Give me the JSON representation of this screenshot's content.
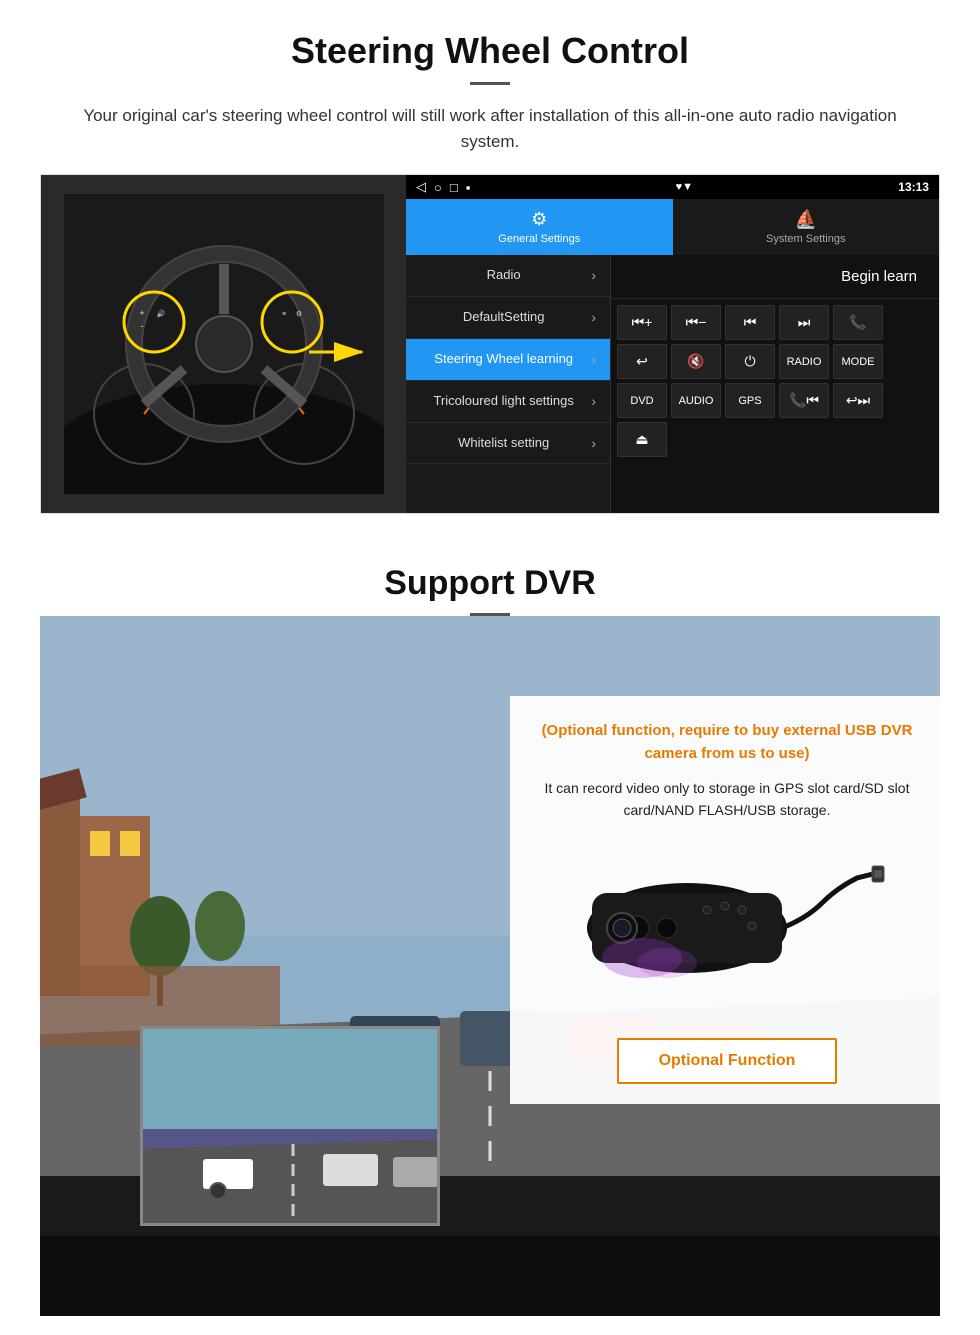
{
  "section1": {
    "title": "Steering Wheel Control",
    "subtitle": "Your original car's steering wheel control will still work after installation of this all-in-one auto radio navigation system.",
    "topbar": {
      "icons": "◁ ○ □ ▪",
      "status": "♥ ▼",
      "time": "13:13"
    },
    "tabs": [
      {
        "icon": "⚙",
        "label": "General Settings",
        "active": true
      },
      {
        "icon": "⛵",
        "label": "System Settings",
        "active": false
      }
    ],
    "menu": [
      {
        "label": "Radio",
        "active": false
      },
      {
        "label": "DefaultSetting",
        "active": false
      },
      {
        "label": "Steering Wheel learning",
        "active": true
      },
      {
        "label": "Tricoloured light settings",
        "active": false
      },
      {
        "label": "Whitelist setting",
        "active": false
      }
    ],
    "begin_learn": "Begin learn",
    "buttons": [
      [
        "⏮+",
        "⏮−",
        "⏮|",
        "⏭|",
        "📞"
      ],
      [
        "↩",
        "🔇×",
        "⏻",
        "RADIO",
        "MODE"
      ],
      [
        "DVD",
        "AUDIO",
        "GPS",
        "📞⏮|",
        "↩⏭|"
      ],
      [
        "⏏"
      ]
    ]
  },
  "section2": {
    "title": "Support DVR",
    "card": {
      "title_text": "(Optional function, require to buy external USB DVR camera from us to use)",
      "body_text": "It can record video only to storage in GPS slot card/SD slot card/NAND FLASH/USB storage."
    },
    "optional_button": "Optional Function"
  }
}
